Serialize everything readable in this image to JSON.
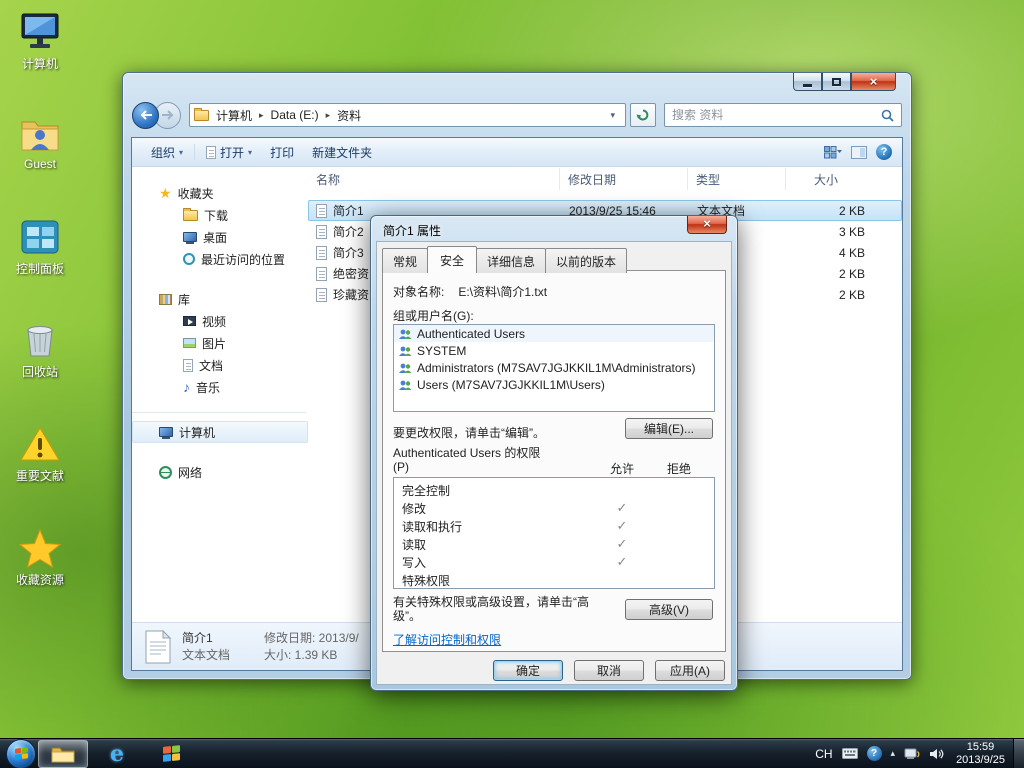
{
  "glyphs": {
    "caret_down": "▾",
    "crumb_sep": "▸",
    "star": "★",
    "music_note": "♪",
    "close": "×",
    "tray_up": "▴",
    "help": "?",
    "ie": "e"
  },
  "desktop": {
    "icons": [
      {
        "label": "计算机"
      },
      {
        "label": "Guest"
      },
      {
        "label": "控制面板"
      },
      {
        "label": "回收站"
      },
      {
        "label": "重要文献"
      },
      {
        "label": "收藏资源"
      }
    ]
  },
  "explorer": {
    "nav": {
      "breadcrumb": [
        "计算机",
        "Data (E:)",
        "资料"
      ],
      "search_placeholder": "搜索 资料"
    },
    "toolbar": {
      "organize": "组织",
      "open": "打开",
      "print": "打印",
      "new_folder": "新建文件夹"
    },
    "sidebar": {
      "items": [
        {
          "label": "收藏夹"
        },
        {
          "label": "下载"
        },
        {
          "label": "桌面"
        },
        {
          "label": "最近访问的位置"
        },
        {
          "label": "库"
        },
        {
          "label": "视频"
        },
        {
          "label": "图片"
        },
        {
          "label": "文档"
        },
        {
          "label": "音乐"
        },
        {
          "label": "计算机"
        },
        {
          "label": "网络"
        }
      ]
    },
    "list": {
      "columns": [
        "名称",
        "修改日期",
        "类型",
        "大小"
      ],
      "rows": [
        {
          "name": "简介1",
          "modified": "2013/9/25 15:46",
          "type": "文本文档",
          "size": "2 KB"
        },
        {
          "name": "简介2",
          "modified": "",
          "type": "",
          "size": "3 KB"
        },
        {
          "name": "简介3",
          "modified": "",
          "type": "",
          "size": "4 KB"
        },
        {
          "name": "绝密资",
          "modified": "",
          "type": "",
          "size": "2 KB"
        },
        {
          "name": "珍藏资",
          "modified": "",
          "type": "",
          "size": "2 KB"
        }
      ]
    },
    "status": {
      "name": "简介1",
      "type": "文本文档",
      "modified": "修改日期: 2013/9/",
      "size": "大小: 1.39 KB"
    }
  },
  "dialog": {
    "title": "简介1 属性",
    "tabs": [
      "常规",
      "安全",
      "详细信息",
      "以前的版本"
    ],
    "object_label": "对象名称:",
    "object_value": "E:\\资料\\简介1.txt",
    "group_label": "组或用户名(G):",
    "users": [
      {
        "name": "Authenticated Users"
      },
      {
        "name": "SYSTEM"
      },
      {
        "name": "Administrators (M7SAV7JGJKKIL1M\\Administrators)"
      },
      {
        "name": "Users (M7SAV7JGJKKIL1M\\Users)"
      }
    ],
    "edit_hint": "要更改权限，请单击“编辑”。",
    "edit_button": "编辑(E)...",
    "perm_title": "Authenticated Users 的权限",
    "perm_title2": "(P)",
    "allow_header": "允许",
    "deny_header": "拒绝",
    "permissions": [
      {
        "name": "完全控制",
        "allow": "",
        "deny": ""
      },
      {
        "name": "修改",
        "allow": "✓",
        "deny": ""
      },
      {
        "name": "读取和执行",
        "allow": "✓",
        "deny": ""
      },
      {
        "name": "读取",
        "allow": "✓",
        "deny": ""
      },
      {
        "name": "写入",
        "allow": "✓",
        "deny": ""
      },
      {
        "name": "特殊权限",
        "allow": "",
        "deny": ""
      }
    ],
    "advanced_hint": "有关特殊权限或高级设置，请单击“高级”。",
    "advanced_button": "高级(V)",
    "learn_link": "了解访问控制和权限",
    "ok_button": "确定",
    "cancel_button": "取消",
    "apply_button": "应用(A)"
  },
  "taskbar": {
    "tray": {
      "language": "CH",
      "time": "15:59",
      "date": "2013/9/25"
    }
  }
}
